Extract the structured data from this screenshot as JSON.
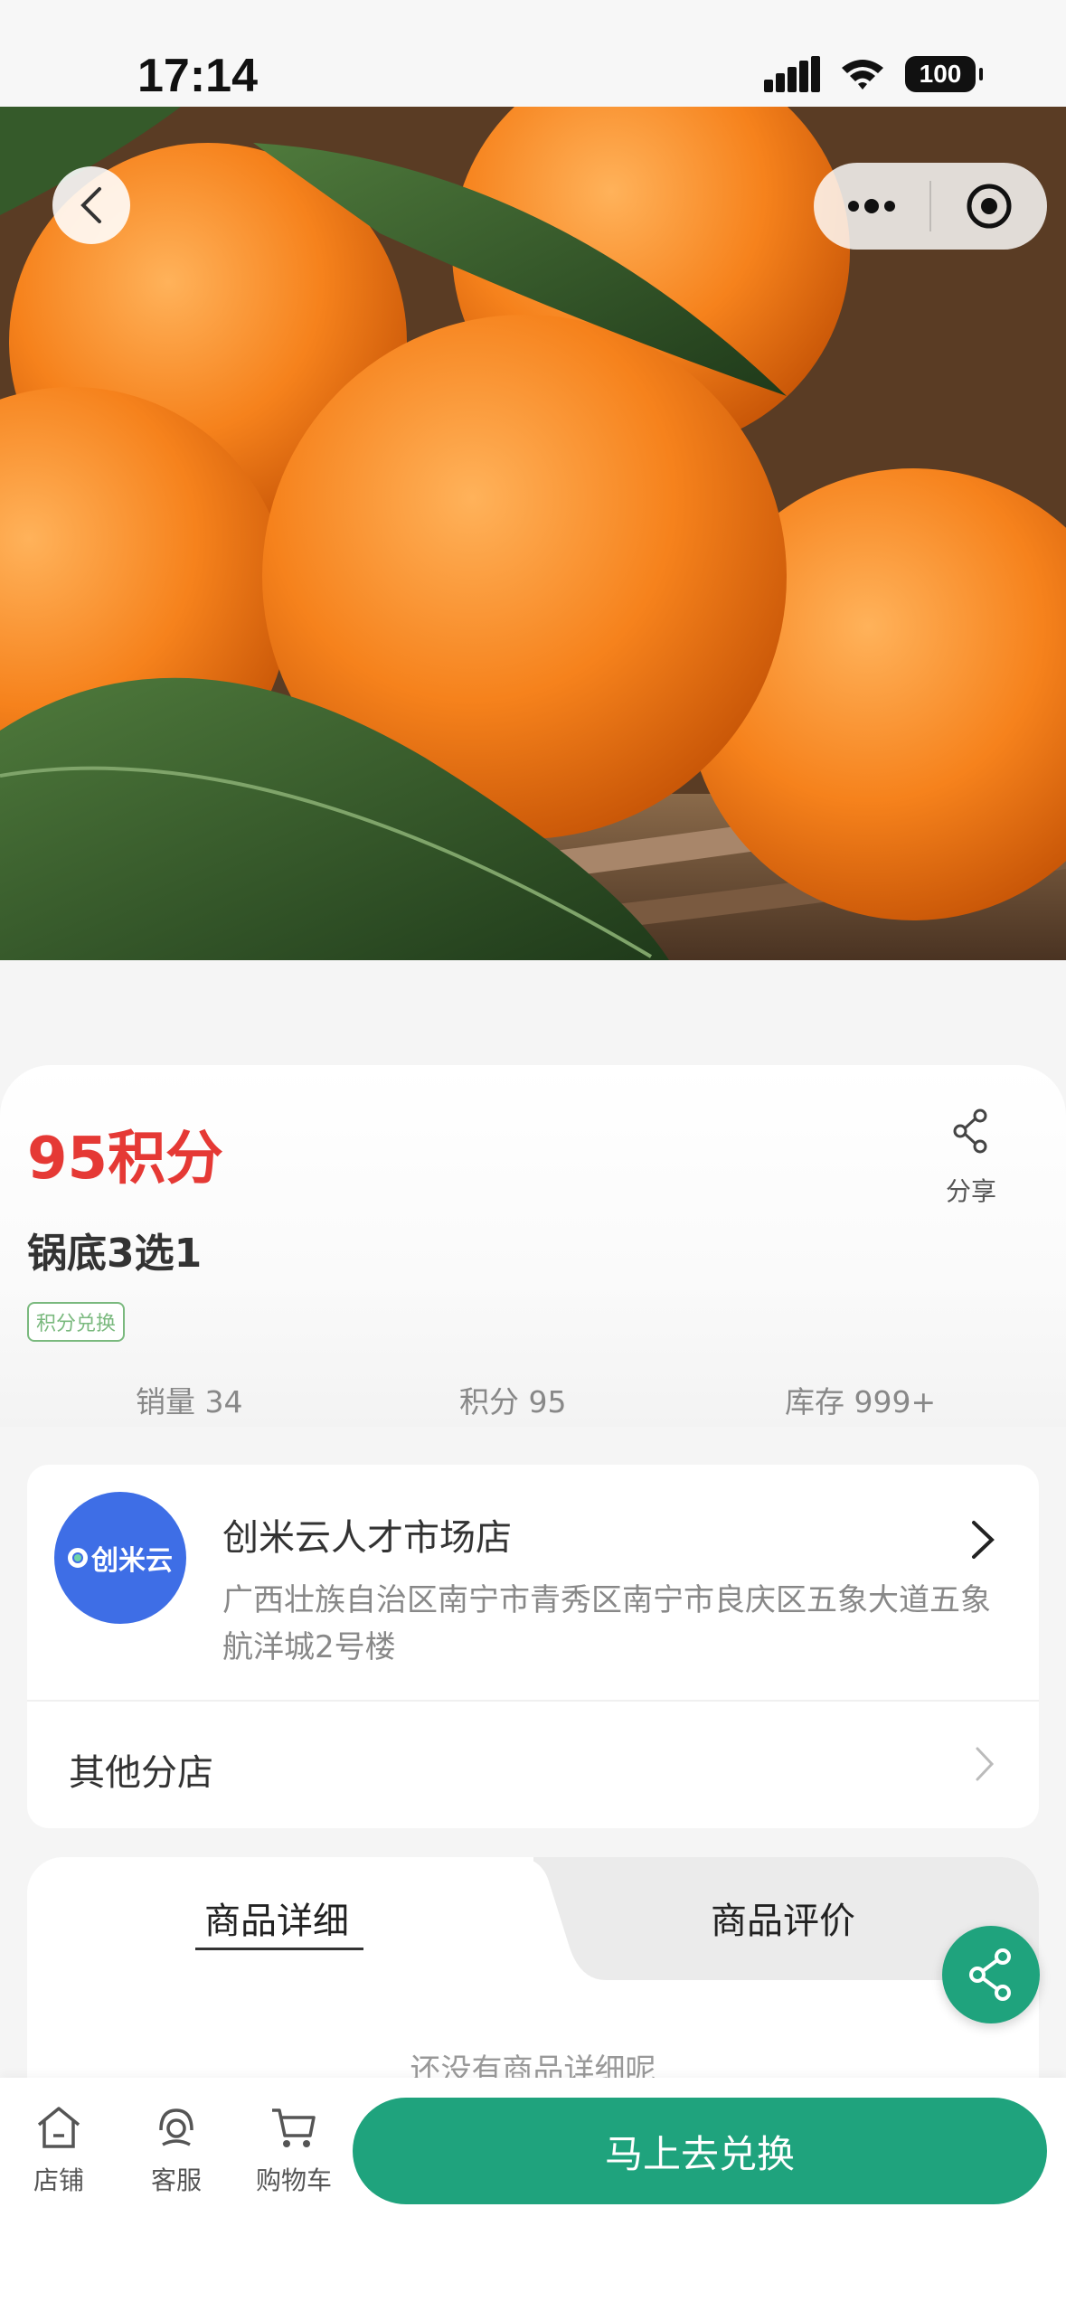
{
  "status": {
    "time": "17:14",
    "battery": "100"
  },
  "product": {
    "price": "95积分",
    "title": "锅底3选1",
    "tag": "积分兑换",
    "share_label": "分享",
    "stats": {
      "sales": "销量 34",
      "points": "积分 95",
      "stock": "库存 999+"
    }
  },
  "store": {
    "logo_text": "创米云",
    "name": "创米云人才市场店",
    "address": "广西壮族自治区南宁市青秀区南宁市良庆区五象大道五象航洋城2号楼",
    "other_branches": "其他分店"
  },
  "tabs": [
    {
      "label": "商品详细",
      "active": true
    },
    {
      "label": "商品评价",
      "active": false
    }
  ],
  "empty_text": "还没有商品详细呢",
  "bottom_nav": {
    "store": "店铺",
    "service": "客服",
    "cart": "购物车",
    "cta": "马上去兑换"
  },
  "colors": {
    "accent": "#1fa37d",
    "price": "#e53935",
    "tag": "#7ab97e",
    "logo": "#3e6ee6"
  }
}
